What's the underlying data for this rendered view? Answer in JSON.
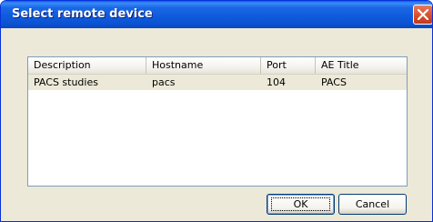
{
  "window": {
    "title": "Select remote device"
  },
  "icons": {
    "close": "close-icon"
  },
  "colors": {
    "titlebar": "#0a5fe8",
    "close_button": "#d8502e",
    "dialog_background": "#ece9d8",
    "selected_row": "#ece9d8"
  },
  "table": {
    "columns": [
      "Description",
      "Hostname",
      "Port",
      "AE Title"
    ],
    "rows": [
      [
        "PACS studies",
        "pacs",
        "104",
        "PACS"
      ]
    ]
  },
  "buttons": {
    "ok_label": "OK",
    "cancel_label": "Cancel"
  }
}
